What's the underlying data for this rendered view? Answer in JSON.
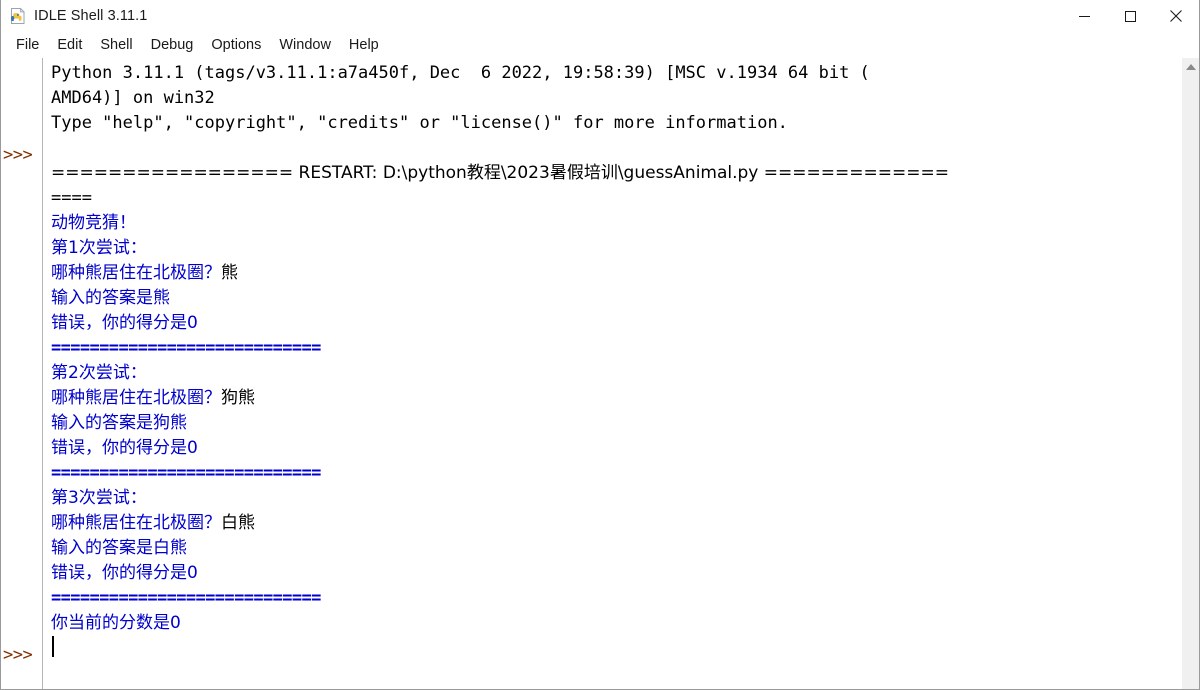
{
  "window": {
    "title": "IDLE Shell 3.11.1",
    "icon": "python-file-icon",
    "controls": {
      "minimize": "minimize-icon",
      "maximize": "maximize-icon",
      "close": "close-icon"
    }
  },
  "menubar": {
    "items": [
      {
        "label": "File"
      },
      {
        "label": "Edit"
      },
      {
        "label": "Shell"
      },
      {
        "label": "Debug"
      },
      {
        "label": "Options"
      },
      {
        "label": "Window"
      },
      {
        "label": "Help"
      }
    ]
  },
  "colors": {
    "output_blue": "#0000cc",
    "prompt_maroon": "#803000",
    "stdin_black": "#000000",
    "background": "#ffffff"
  },
  "shell": {
    "prompts": [
      ">>>",
      ">>>"
    ],
    "banner": {
      "line1": "Python 3.11.1 (tags/v3.11.1:a7a450f, Dec  6 2022, 19:58:39) [MSC v.1934 64 bit (",
      "line2": "AMD64)] on win32",
      "line3": "Type \"help\", \"copyright\", \"credits\" or \"license()\" for more information."
    },
    "restart": {
      "line1": "================= RESTART: D:\\python教程\\2023暑假培训\\guessAnimal.py =============",
      "line2": "===="
    },
    "separator": "============================",
    "output": {
      "title": "动物竞猜！",
      "attempts": [
        {
          "header": "第1次尝试：",
          "question": "哪种熊居住在北极圈？",
          "answer": "熊",
          "echo": "输入的答案是熊",
          "result": "错误，你的得分是0"
        },
        {
          "header": "第2次尝试：",
          "question": "哪种熊居住在北极圈？",
          "answer": "狗熊",
          "echo": "输入的答案是狗熊",
          "result": "错误，你的得分是0"
        },
        {
          "header": "第3次尝试：",
          "question": "哪种熊居住在北极圈？",
          "answer": "白熊",
          "echo": "输入的答案是白熊",
          "result": "错误，你的得分是0"
        }
      ],
      "final_score": "你当前的分数是0"
    }
  },
  "scrollbar": {
    "up_arrow": "scroll-up-arrow-icon"
  }
}
